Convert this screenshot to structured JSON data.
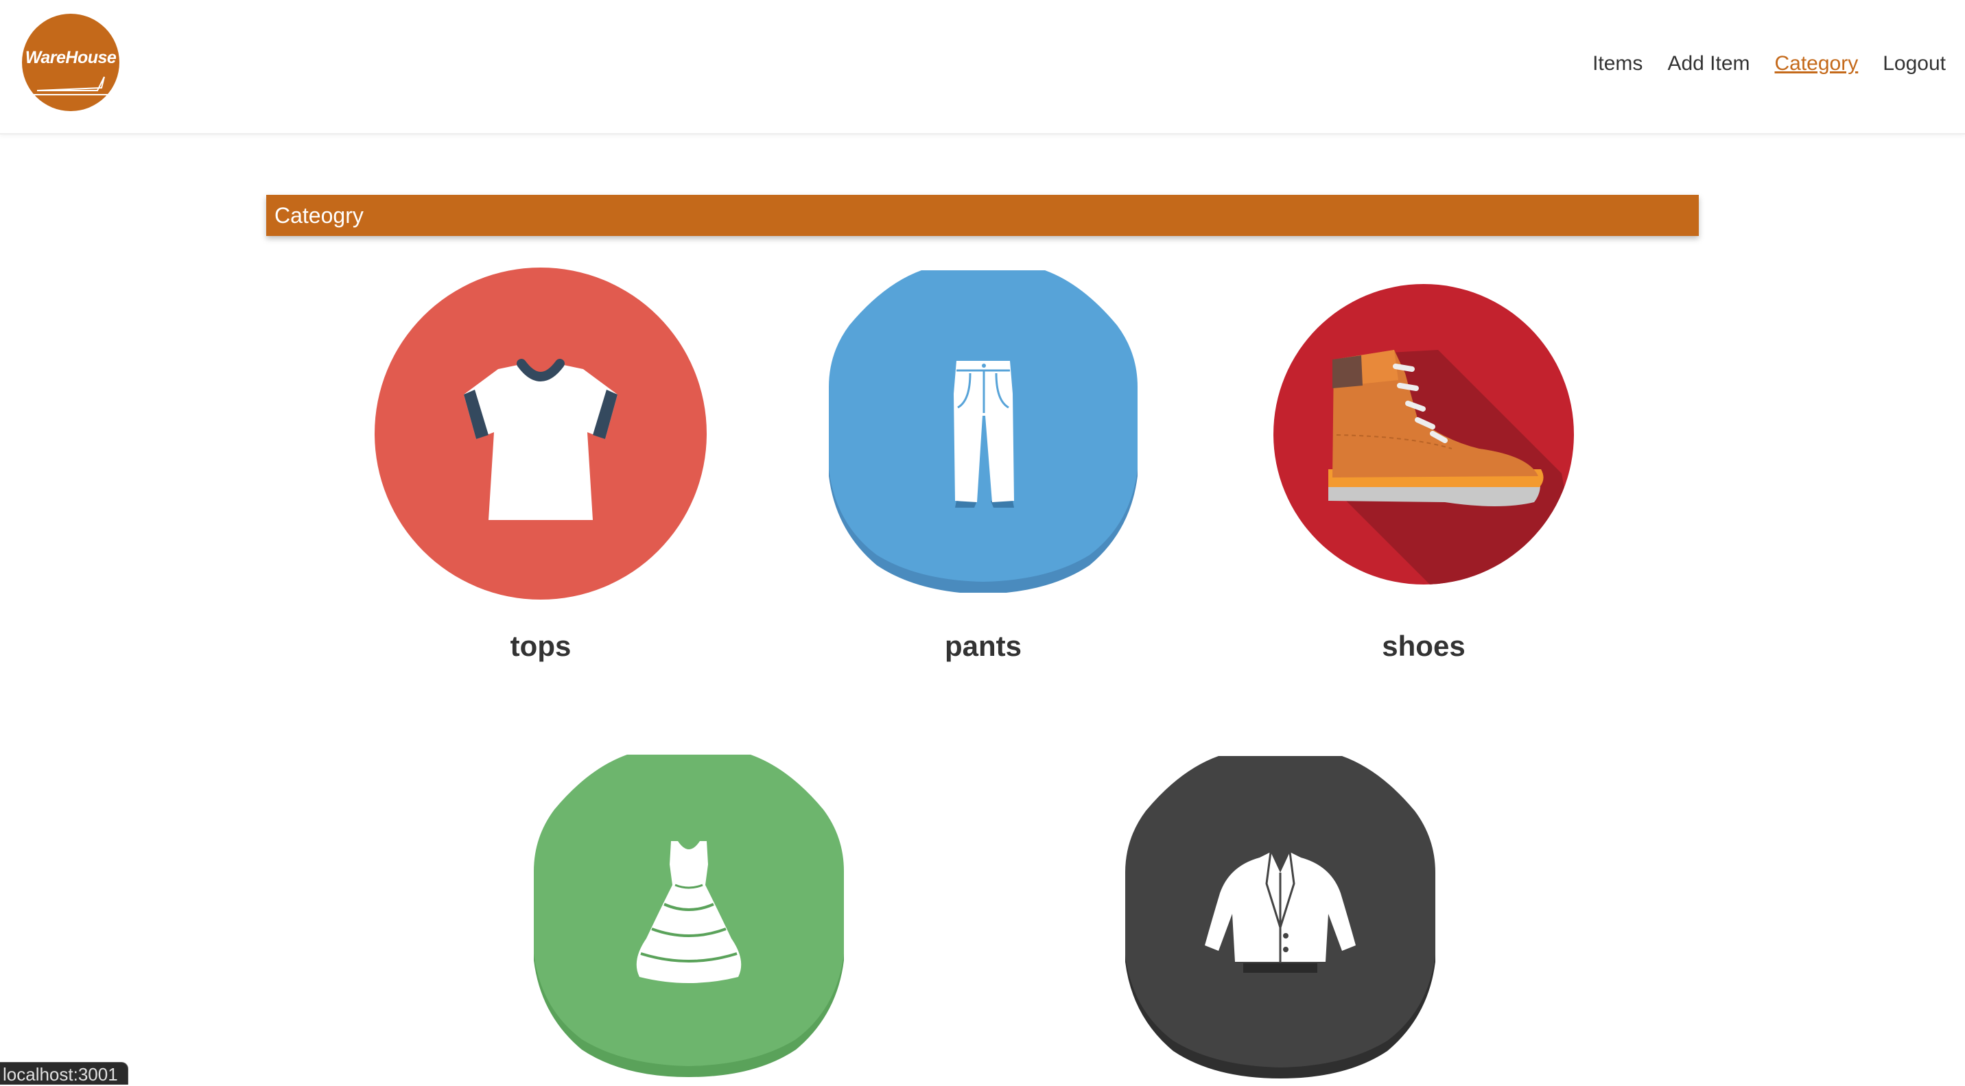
{
  "header": {
    "logo_text": "WareHouse",
    "nav": [
      {
        "label": "Items",
        "active": false
      },
      {
        "label": "Add Item",
        "active": false
      },
      {
        "label": "Category",
        "active": true
      },
      {
        "label": "Logout",
        "active": false
      }
    ]
  },
  "section": {
    "title": "Cateogry"
  },
  "categories": [
    {
      "label": "tops",
      "icon": "tshirt-icon",
      "color": "#e15b4f"
    },
    {
      "label": "pants",
      "icon": "pants-icon",
      "color": "#57a3d8"
    },
    {
      "label": "shoes",
      "icon": "boot-icon",
      "color": "#c3222e"
    },
    {
      "label": "",
      "icon": "dress-icon",
      "color": "#6db56d"
    },
    {
      "label": "",
      "icon": "jacket-icon",
      "color": "#434343"
    }
  ],
  "status": {
    "url": "localhost:3001"
  },
  "colors": {
    "accent": "#c4691a",
    "text": "#333333"
  }
}
